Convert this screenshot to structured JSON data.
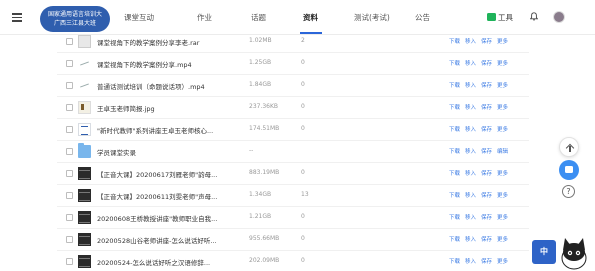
{
  "course": {
    "badge_line1": "国家通用语言培训大",
    "badge_line2": "广西三江县大班"
  },
  "nav": {
    "tabs": [
      {
        "label": "课堂互动"
      },
      {
        "label": "作业"
      },
      {
        "label": "话题"
      },
      {
        "label": "资料",
        "active": true
      },
      {
        "label": "测试(考试)"
      },
      {
        "label": "公告"
      }
    ],
    "tool_label": "工具"
  },
  "files": [
    {
      "name": "课堂视角下的教学案例分享李老.rar",
      "size": "1.02MB",
      "count": "2",
      "icon": "archive"
    },
    {
      "name": "课堂视角下的教学案例分享.mp4",
      "size": "1.25GB",
      "count": "0",
      "icon": "audio"
    },
    {
      "name": "普通话测试培训（命题说话项）.mp4",
      "size": "1.84GB",
      "count": "0",
      "icon": "audio"
    },
    {
      "name": "王卓玉老师简报.jpg",
      "size": "237.36KB",
      "count": "0",
      "icon": "image"
    },
    {
      "name": "\"新时代教师\"系列讲座王卓玉老师核心...",
      "size": "174.51MB",
      "count": "0",
      "icon": "doc"
    },
    {
      "name": "学员课堂实录",
      "size": "--",
      "count": "",
      "icon": "folder"
    },
    {
      "name": "【正音大课】20200617刘雁老师\"韵母...",
      "size": "883.19MB",
      "count": "0",
      "icon": "video"
    },
    {
      "name": "【正音大课】20200611刘雯老师\"声母...",
      "size": "1.34GB",
      "count": "13",
      "icon": "video"
    },
    {
      "name": "20200608王桥教授讲座\"教师职业自我...",
      "size": "1.21GB",
      "count": "0",
      "icon": "video"
    },
    {
      "name": "20200528山谷老师讲座-怎么说话好听...",
      "size": "955.66MB",
      "count": "0",
      "icon": "video"
    },
    {
      "name": "20200524-怎么说话好听之汉语修辞...",
      "size": "202.09MB",
      "count": "0",
      "icon": "video"
    }
  ],
  "row_actions": {
    "download": "下载",
    "import": "移入",
    "save": "保存",
    "more": "更多",
    "edit": "编辑"
  },
  "helper_label": "中",
  "help_symbol": "?"
}
